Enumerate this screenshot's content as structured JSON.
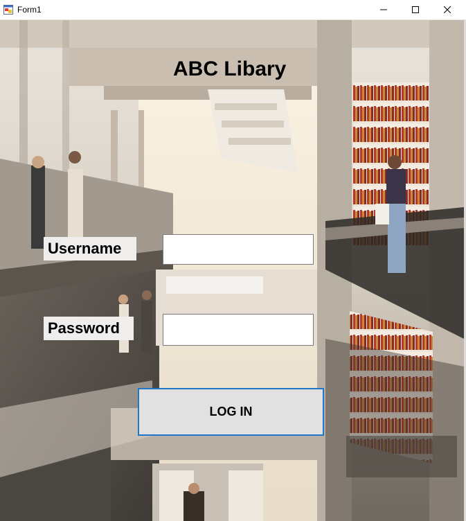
{
  "window": {
    "title": "Form1",
    "icon": "winforms-app-icon",
    "controls": [
      "minimize-icon",
      "maximize-icon",
      "close-icon"
    ]
  },
  "form": {
    "heading": "ABC Libary",
    "username_label": "Username",
    "username_value": "",
    "password_label": "Password",
    "password_value": "",
    "login_button": "LOG IN"
  },
  "colors": {
    "button_border": "#1f77c9",
    "button_face": "#e1e1e1",
    "label_background": "#f0eeec"
  }
}
